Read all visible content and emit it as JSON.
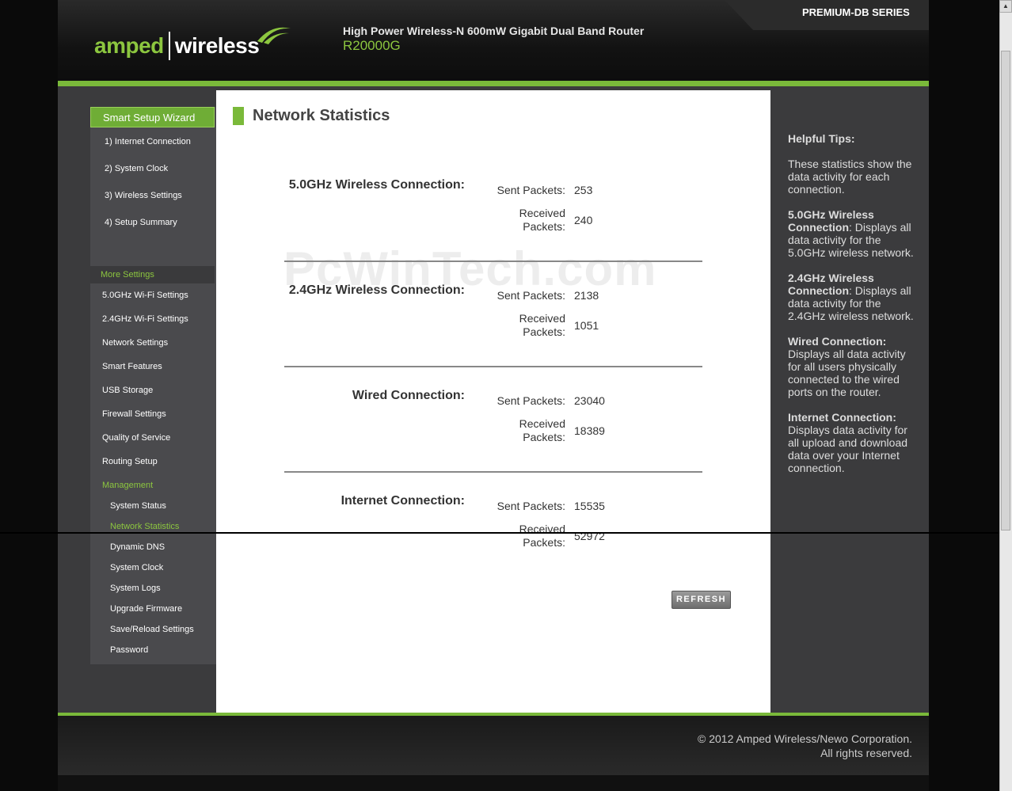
{
  "header": {
    "logo_amped": "amped",
    "logo_wireless": "wireless",
    "router_title": "High Power Wireless-N 600mW Gigabit Dual Band Router",
    "router_model": "R20000G",
    "series": "PREMIUM-DB SERIES"
  },
  "sidebar": {
    "wizard": "Smart Setup Wizard",
    "wizard_items": [
      "1) Internet Connection",
      "2) System Clock",
      "3) Wireless Settings",
      "4) Setup Summary"
    ],
    "more_settings": "More Settings",
    "settings_items": [
      "5.0GHz Wi-Fi Settings",
      "2.4GHz Wi-Fi Settings",
      "Network Settings",
      "Smart Features",
      "USB Storage",
      "Firewall Settings",
      "Quality of Service",
      "Routing Setup"
    ],
    "management": "Management",
    "management_items": [
      "System Status",
      "Network Statistics",
      "Dynamic DNS",
      "System Clock",
      "System Logs",
      "Upgrade Firmware",
      "Save/Reload Settings",
      "Password"
    ]
  },
  "main": {
    "title": "Network Statistics",
    "watermark": "PcWinTech.com",
    "sent_label": "Sent Packets:",
    "received_label_1": "Received",
    "received_label_2": "Packets:",
    "sections": [
      {
        "label": "5.0GHz Wireless Connection:",
        "sent": "253",
        "received": "240"
      },
      {
        "label": "2.4GHz Wireless Connection:",
        "sent": "2138",
        "received": "1051"
      },
      {
        "label": "Wired Connection:",
        "sent": "23040",
        "received": "18389"
      },
      {
        "label": "Internet Connection:",
        "sent": "15535",
        "received": "52972"
      }
    ],
    "refresh": "REFRESH"
  },
  "tips": {
    "title": "Helpful Tips:",
    "intro": "These statistics show the data activity for each connection.",
    "items": [
      {
        "head": "5.0GHz Wireless Connection",
        "sep": ":",
        "body": " Displays all data activity for the 5.0GHz wireless network."
      },
      {
        "head": "2.4GHz Wireless Connection",
        "sep": ":",
        "body": " Displays all data activity for the 2.4GHz wireless network."
      },
      {
        "head": "Wired Connection:",
        "sep": "",
        "body": " Displays all data activity for all users physically connected to the wired ports on the router."
      },
      {
        "head": "Internet Connection:",
        "sep": "",
        "body": " Displays data activity for all upload and download data over your Internet connection."
      }
    ]
  },
  "footer": {
    "copyright": "© 2012 Amped Wireless/Newo Corporation.",
    "rights": "All rights reserved."
  },
  "colors": {
    "accent": "#7ab93a",
    "logo_green": "#8cc63f",
    "panel": "#3b3b3d"
  }
}
